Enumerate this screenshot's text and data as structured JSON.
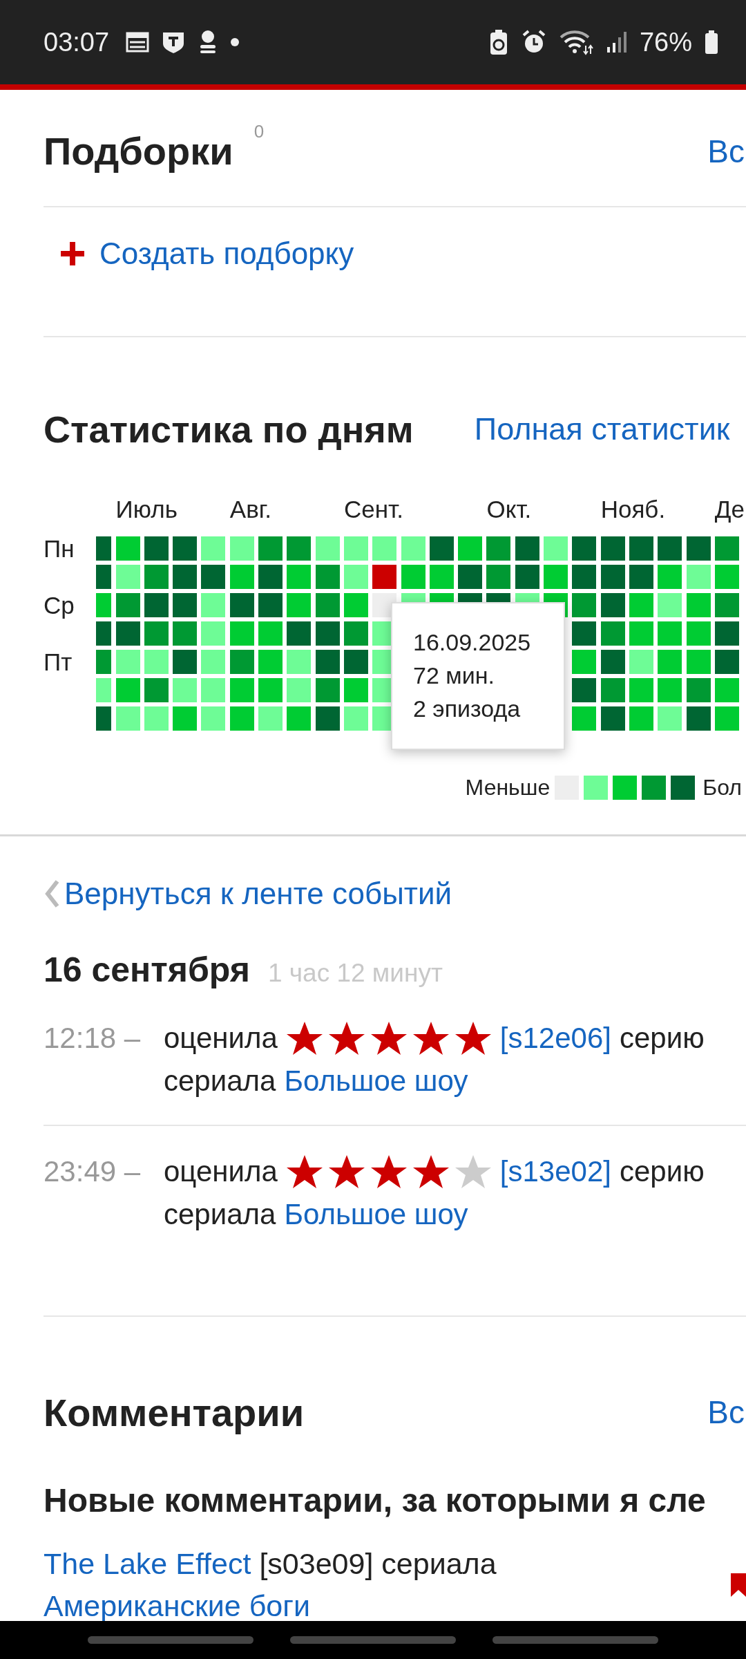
{
  "status_bar": {
    "time": "03:07",
    "battery": "76%"
  },
  "collections": {
    "title": "Подборки",
    "count": "0",
    "all_link": "Вс",
    "create": "Создать подборку"
  },
  "stats": {
    "title": "Статистика по дням",
    "full_link": "Полная статистик",
    "day_labels": [
      "Пн",
      "Ср",
      "Пт"
    ],
    "weeks": [
      {
        "days": [
          {
            "color": "#006633"
          },
          {
            "color": "#006633"
          },
          {
            "color": "#00cc33"
          },
          {
            "color": "#006633"
          },
          {
            "color": "#009933"
          },
          {
            "color": "#6efc96"
          },
          {
            "color": "#006633"
          }
        ]
      },
      {
        "month": "Июль",
        "days": [
          {
            "color": "#00cc33"
          },
          {
            "color": "#6efc96"
          },
          {
            "color": "#009933"
          },
          {
            "color": "#006633"
          },
          {
            "color": "#6efc96"
          },
          {
            "color": "#00cc33"
          },
          {
            "color": "#6efc96"
          }
        ]
      },
      {
        "days": [
          {
            "color": "#006633"
          },
          {
            "color": "#009933"
          },
          {
            "color": "#006633"
          },
          {
            "color": "#009933"
          },
          {
            "color": "#6efc96"
          },
          {
            "color": "#009933"
          },
          {
            "color": "#6efc96"
          }
        ]
      },
      {
        "days": [
          {
            "color": "#006633"
          },
          {
            "color": "#006633"
          },
          {
            "color": "#006633"
          },
          {
            "color": "#009933"
          },
          {
            "color": "#006633"
          },
          {
            "color": "#6efc96"
          },
          {
            "color": "#00cc33"
          }
        ]
      },
      {
        "days": [
          {
            "color": "#6efc96"
          },
          {
            "color": "#006633"
          },
          {
            "color": "#6efc96"
          },
          {
            "color": "#6efc96"
          },
          {
            "color": "#6efc96"
          },
          {
            "color": "#6efc96"
          },
          {
            "color": "#6efc96"
          }
        ]
      },
      {
        "month": "Авг.",
        "days": [
          {
            "color": "#6efc96"
          },
          {
            "color": "#00cc33"
          },
          {
            "color": "#006633"
          },
          {
            "color": "#00cc33"
          },
          {
            "color": "#009933"
          },
          {
            "color": "#00cc33"
          },
          {
            "color": "#00cc33"
          }
        ]
      },
      {
        "days": [
          {
            "color": "#009933"
          },
          {
            "color": "#006633"
          },
          {
            "color": "#006633"
          },
          {
            "color": "#00cc33"
          },
          {
            "color": "#00cc33"
          },
          {
            "color": "#00cc33"
          },
          {
            "color": "#6efc96"
          }
        ]
      },
      {
        "days": [
          {
            "color": "#009933"
          },
          {
            "color": "#00cc33"
          },
          {
            "color": "#00cc33"
          },
          {
            "color": "#006633"
          },
          {
            "color": "#6efc96"
          },
          {
            "color": "#6efc96"
          },
          {
            "color": "#00cc33"
          }
        ]
      },
      {
        "days": [
          {
            "color": "#6efc96"
          },
          {
            "color": "#009933"
          },
          {
            "color": "#009933"
          },
          {
            "color": "#006633"
          },
          {
            "color": "#006633"
          },
          {
            "color": "#009933"
          },
          {
            "color": "#006633"
          }
        ]
      },
      {
        "month": "Сент.",
        "days": [
          {
            "color": "#6efc96"
          },
          {
            "color": "#6efc96"
          },
          {
            "color": "#00cc33"
          },
          {
            "color": "#009933"
          },
          {
            "color": "#006633"
          },
          {
            "color": "#00cc33"
          },
          {
            "color": "#6efc96"
          }
        ]
      },
      {
        "days": [
          {
            "color": "#6efc96"
          },
          {
            "color": "#cc0000"
          },
          {
            "color": "#eeeeee"
          },
          {
            "color": "#6efc96"
          },
          {
            "color": "#6efc96"
          },
          {
            "color": "#6efc96"
          },
          {
            "color": "#6efc96"
          }
        ]
      },
      {
        "days": [
          {
            "color": "#6efc96"
          },
          {
            "color": "#00cc33"
          },
          {
            "color": "#6efc96"
          }
        ]
      },
      {
        "days": [
          {
            "color": "#006633"
          },
          {
            "color": "#00cc33"
          },
          {
            "color": "#00cc33"
          }
        ]
      },
      {
        "days": [
          {
            "color": "#00cc33"
          },
          {
            "color": "#006633"
          },
          {
            "color": "#006633"
          }
        ]
      },
      {
        "month": "Окт.",
        "days": [
          {
            "color": "#009933"
          },
          {
            "color": "#009933"
          },
          {
            "color": "#006633"
          }
        ]
      },
      {
        "days": [
          {
            "color": "#006633"
          },
          {
            "color": "#006633"
          },
          {
            "color": "#6efc96"
          }
        ]
      },
      {
        "days": [
          {
            "color": "#6efc96"
          },
          {
            "color": "#00cc33"
          },
          {
            "color": "#00cc33"
          }
        ]
      },
      {
        "days": [
          {
            "color": "#006633"
          },
          {
            "color": "#006633"
          },
          {
            "color": "#009933"
          },
          {
            "color": "#006633"
          },
          {
            "color": "#00cc33"
          },
          {
            "color": "#006633"
          },
          {
            "color": "#00cc33"
          }
        ]
      },
      {
        "month": "Нояб.",
        "days": [
          {
            "color": "#006633"
          },
          {
            "color": "#006633"
          },
          {
            "color": "#006633"
          },
          {
            "color": "#009933"
          },
          {
            "color": "#006633"
          },
          {
            "color": "#009933"
          },
          {
            "color": "#006633"
          }
        ]
      },
      {
        "days": [
          {
            "color": "#006633"
          },
          {
            "color": "#006633"
          },
          {
            "color": "#00cc33"
          },
          {
            "color": "#00cc33"
          },
          {
            "color": "#6efc96"
          },
          {
            "color": "#00cc33"
          },
          {
            "color": "#00cc33"
          }
        ]
      },
      {
        "days": [
          {
            "color": "#006633"
          },
          {
            "color": "#00cc33"
          },
          {
            "color": "#6efc96"
          },
          {
            "color": "#00cc33"
          },
          {
            "color": "#00cc33"
          },
          {
            "color": "#00cc33"
          },
          {
            "color": "#6efc96"
          }
        ]
      },
      {
        "days": [
          {
            "color": "#006633"
          },
          {
            "color": "#6efc96"
          },
          {
            "color": "#00cc33"
          },
          {
            "color": "#00cc33"
          },
          {
            "color": "#00cc33"
          },
          {
            "color": "#009933"
          },
          {
            "color": "#006633"
          }
        ]
      },
      {
        "month": "Де",
        "days": [
          {
            "color": "#009933"
          },
          {
            "color": "#00cc33"
          },
          {
            "color": "#009933"
          },
          {
            "color": "#006633"
          },
          {
            "color": "#006633"
          },
          {
            "color": "#00cc33"
          },
          {
            "color": "#00cc33"
          }
        ]
      }
    ],
    "tooltip": [
      "16.09.2025",
      "72 мин.",
      "2 эпизода"
    ],
    "legend": {
      "less": "Меньше",
      "more": "Бол"
    }
  },
  "feed": {
    "back_link": "Вернуться к ленте событий",
    "date": "16 сентября",
    "duration": "1 час 12 минут",
    "events": [
      {
        "time": "12:18 –",
        "verb": "оценила",
        "stars": 5,
        "episode": "[s12e06]",
        "object": "серию",
        "prefix": "сериала",
        "show": "Большое шоу"
      },
      {
        "time": "23:49 –",
        "verb": "оценила",
        "stars": 4,
        "episode": "[s13e02]",
        "object": "серию",
        "prefix": "сериала",
        "show": "Большое шоу"
      }
    ]
  },
  "comments": {
    "title": "Комментарии",
    "all_link": "Вс",
    "subtitle": "Новые комментарии, за которыми я сле",
    "items": [
      {
        "episode_title": "The Lake Effect",
        "episode": "[s03e09] сериала",
        "show": "Американские боги"
      }
    ]
  }
}
